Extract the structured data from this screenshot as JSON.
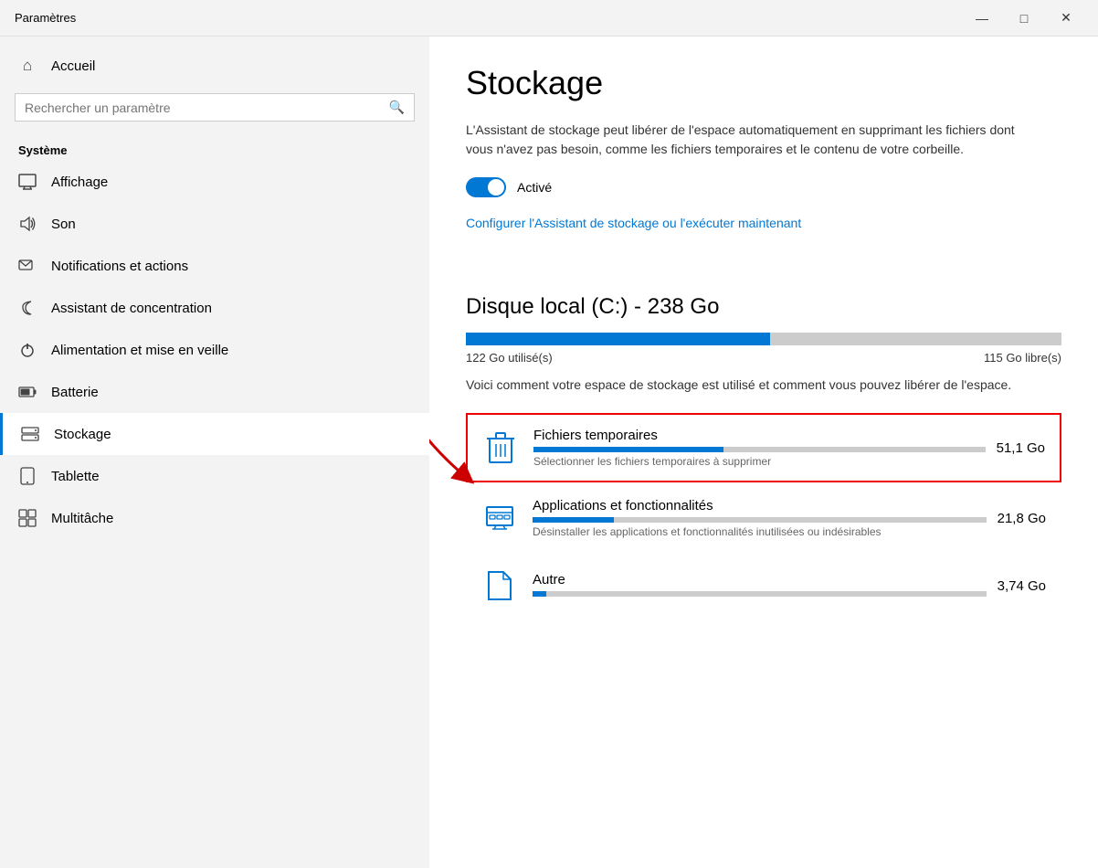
{
  "titlebar": {
    "title": "Paramètres",
    "minimize": "—",
    "maximize": "□",
    "close": "✕"
  },
  "sidebar": {
    "home_label": "Accueil",
    "search_placeholder": "Rechercher un paramètre",
    "section_label": "Système",
    "nav_items": [
      {
        "id": "affichage",
        "label": "Affichage",
        "icon": "monitor"
      },
      {
        "id": "son",
        "label": "Son",
        "icon": "sound"
      },
      {
        "id": "notifications",
        "label": "Notifications et actions",
        "icon": "notif"
      },
      {
        "id": "concentration",
        "label": "Assistant de concentration",
        "icon": "moon"
      },
      {
        "id": "alimentation",
        "label": "Alimentation et mise en veille",
        "icon": "power"
      },
      {
        "id": "batterie",
        "label": "Batterie",
        "icon": "battery"
      },
      {
        "id": "stockage",
        "label": "Stockage",
        "icon": "storage",
        "active": true
      },
      {
        "id": "tablette",
        "label": "Tablette",
        "icon": "tablet"
      },
      {
        "id": "multitache",
        "label": "Multitâche",
        "icon": "multitask"
      }
    ]
  },
  "content": {
    "page_title": "Stockage",
    "description": "L'Assistant de stockage peut libérer de l'espace automatiquement en supprimant les fichiers dont vous n'avez pas besoin, comme les fichiers temporaires et le contenu de votre corbeille.",
    "toggle_label": "Activé",
    "config_link": "Configurer l'Assistant de stockage ou l'exécuter maintenant",
    "disk_title": "Disque local (C:) - 238 Go",
    "used_label": "122 Go utilisé(s)",
    "free_label": "115 Go libre(s)",
    "used_percent": 51,
    "storage_desc": "Voici comment votre espace de stockage est utilisé et comment vous pouvez libérer de l'espace.",
    "storage_items": [
      {
        "id": "temp",
        "name": "Fichiers temporaires",
        "size": "51,1 Go",
        "bar_percent": 42,
        "sub": "Sélectionner les fichiers temporaires à supprimer",
        "highlighted": true
      },
      {
        "id": "apps",
        "name": "Applications et fonctionnalités",
        "size": "21,8 Go",
        "bar_percent": 18,
        "sub": "Désinstaller les applications et fonctionnalités inutilisées ou indésirables",
        "highlighted": false
      },
      {
        "id": "autre",
        "name": "Autre",
        "size": "3,74 Go",
        "bar_percent": 3,
        "sub": "",
        "highlighted": false
      }
    ]
  },
  "icons": {
    "monitor": "🖥",
    "sound": "🔊",
    "notif": "💬",
    "moon": "🌙",
    "power": "⏻",
    "battery": "🔋",
    "storage": "💾",
    "tablet": "📱",
    "multitask": "⊞",
    "home": "⌂",
    "search": "🔍",
    "trash": "🗑",
    "apps_icon": "⊞"
  }
}
